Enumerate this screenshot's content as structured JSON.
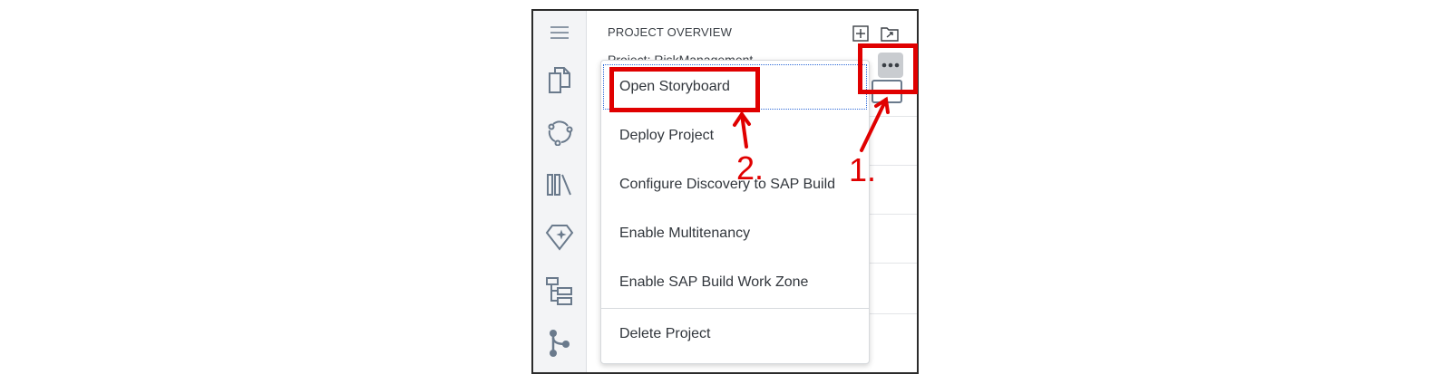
{
  "panel": {
    "title": "PROJECT OVERVIEW",
    "project_line": "Project: RiskManagement"
  },
  "activity_bar": {
    "icons": [
      "menu-icon",
      "explorer-icon",
      "workflow-icon",
      "library-icon",
      "diamond-star-icon",
      "tree-structure-icon",
      "source-control-icon"
    ]
  },
  "header_buttons": [
    "add-icon",
    "open-folder-icon"
  ],
  "context_menu": {
    "items": [
      "Open Storyboard",
      "Deploy Project",
      "Configure Discovery to SAP Build",
      "Enable Multitenancy",
      "Enable SAP Build Work Zone",
      "Delete Project"
    ]
  },
  "annotations": {
    "step1": "1.",
    "step2": "2.",
    "color": "#e00000"
  },
  "colors": {
    "activity_bar_bg": "#f3f4f6",
    "icon": "#6a7a8c",
    "text": "#31363c",
    "focus_outline": "#2f6bd8",
    "more_button_bg": "#c9ccd0"
  }
}
